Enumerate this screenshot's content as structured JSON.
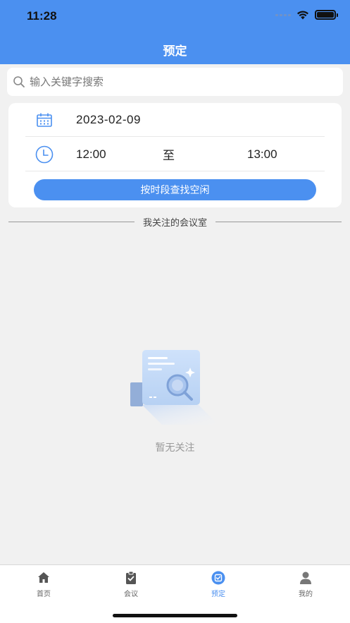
{
  "status_bar": {
    "time": "11:28"
  },
  "header": {
    "title": "预定"
  },
  "search": {
    "placeholder": "输入关键字搜索",
    "icon": "search-icon"
  },
  "booking": {
    "date": "2023-02-09",
    "start_time": "12:00",
    "to_label": "至",
    "end_time": "13:00",
    "find_button": "按时段查找空闲"
  },
  "followed": {
    "section_title": "我关注的会议室",
    "empty_text": "暂无关注"
  },
  "tabbar": {
    "items": [
      {
        "label": "首页",
        "icon": "home-icon",
        "active": false
      },
      {
        "label": "会议",
        "icon": "clipboard-check-icon",
        "active": false
      },
      {
        "label": "预定",
        "icon": "booking-icon",
        "active": true
      },
      {
        "label": "我的",
        "icon": "user-icon",
        "active": false
      }
    ]
  },
  "colors": {
    "primary": "#4b90f0",
    "background": "#f1f1f1",
    "tab_inactive": "#666666"
  }
}
